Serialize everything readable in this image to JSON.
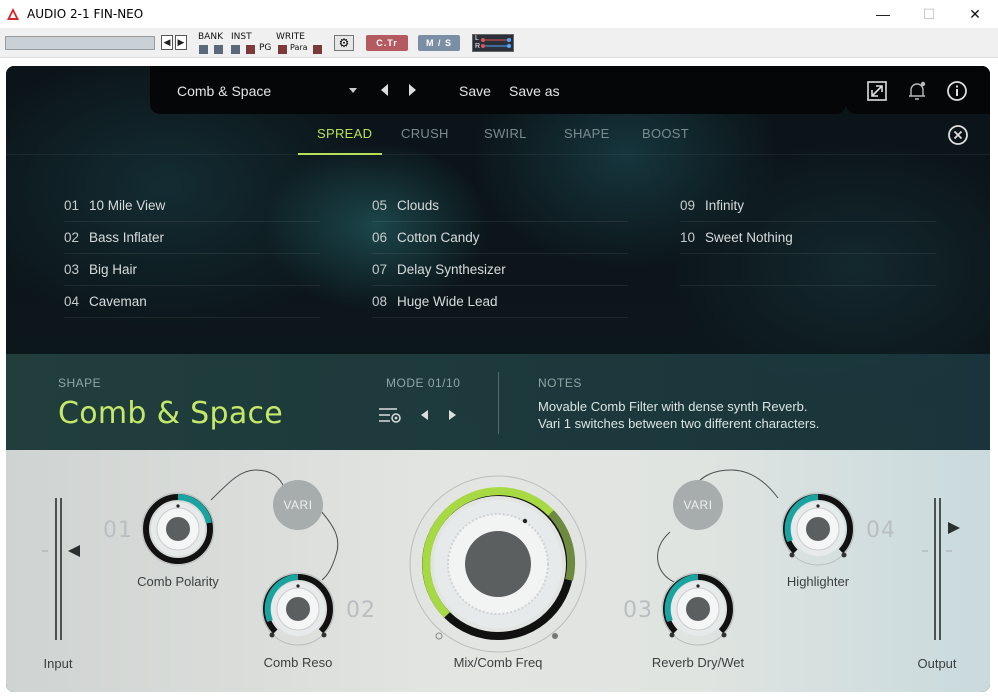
{
  "window": {
    "title": "AUDIO 2-1 FIN-NEO",
    "minimize": "—",
    "maximize": "☐",
    "close": "✕"
  },
  "host": {
    "bank_label": "BANK",
    "inst_label": "INST",
    "pg_label": "PG",
    "write_label": "WRITE",
    "para_label": "Para",
    "ctr_label": "C.Tr",
    "ms_label": "M / S",
    "l_label": "L",
    "r_label": "R"
  },
  "toolbar": {
    "preset": "Comb & Space",
    "save_label": "Save",
    "save_as_label": "Save as"
  },
  "tabs": [
    {
      "label": "SPREAD",
      "active": true
    },
    {
      "label": "CRUSH",
      "active": false
    },
    {
      "label": "SWIRL",
      "active": false
    },
    {
      "label": "SHAPE",
      "active": false
    },
    {
      "label": "BOOST",
      "active": false
    }
  ],
  "presets": [
    [
      {
        "num": "01",
        "name": "10 Mile View"
      },
      {
        "num": "02",
        "name": "Bass Inflater"
      },
      {
        "num": "03",
        "name": "Big Hair"
      },
      {
        "num": "04",
        "name": "Caveman"
      }
    ],
    [
      {
        "num": "05",
        "name": "Clouds"
      },
      {
        "num": "06",
        "name": "Cotton Candy"
      },
      {
        "num": "07",
        "name": "Delay Synthesizer"
      },
      {
        "num": "08",
        "name": "Huge Wide Lead"
      }
    ],
    [
      {
        "num": "09",
        "name": "Infinity"
      },
      {
        "num": "10",
        "name": "Sweet Nothing"
      }
    ]
  ],
  "info": {
    "shape_label": "SHAPE",
    "shape_name": "Comb & Space",
    "mode_label": "MODE 01/10",
    "notes_label": "NOTES",
    "notes_line1": "Movable Comb Filter with dense synth Reverb.",
    "notes_line2": "Vari 1 switches between two different characters."
  },
  "controls": {
    "input_label": "Input",
    "output_label": "Output",
    "vari1": "VARI",
    "vari2": "VARI",
    "knob1": {
      "label": "Comb Polarity",
      "num": "01",
      "value": 0.35
    },
    "knob2": {
      "label": "Comb Reso",
      "num": "02",
      "value": 0.5
    },
    "knob_main": {
      "label": "Mix/Comb Freq",
      "value": 0.62
    },
    "knob3": {
      "label": "Reverb Dry/Wet",
      "num": "03",
      "value": 0.5
    },
    "knob4": {
      "label": "Highlighter",
      "num": "04",
      "value": 0.5
    }
  },
  "colors": {
    "accent": "#b7e05a",
    "teal": "#1aa3a0"
  }
}
